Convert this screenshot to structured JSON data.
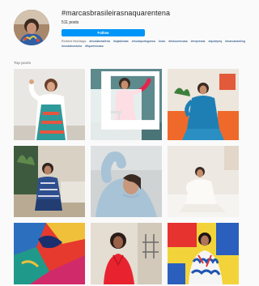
{
  "hashtag": {
    "title": "#marcasbrasileirasnaquarentena",
    "post_count": "511 posts",
    "follow_label": "Follow"
  },
  "related": {
    "label": "Related Hashtags:",
    "tags": [
      "#modabrasileira",
      "#lojaslindas",
      "#modaportuguesa",
      "#ocio",
      "#estouemcasa",
      "#empresas",
      "#apoiepeq",
      "#marcasdoblog",
      "#modaborracha",
      "#fiqueemcasa"
    ]
  },
  "section": {
    "label": "Top posts"
  },
  "posts": [
    {
      "name": "post-woman-paisley-dress-white-wall",
      "multi": false
    },
    {
      "name": "post-woman-red-outfit-sitting",
      "multi": true
    },
    {
      "name": "post-woman-blue-dress-orange-chairs",
      "multi": false
    },
    {
      "name": "post-woman-sitting-living-room",
      "multi": false
    },
    {
      "name": "post-woman-blue-sweater-closeup",
      "multi": false
    },
    {
      "name": "post-woman-white-outfit-bed",
      "multi": false
    },
    {
      "name": "post-colorful-fabric-close",
      "multi": false
    },
    {
      "name": "post-woman-red-shirt-kitchen",
      "multi": false
    },
    {
      "name": "post-woman-patterned-shirt-colorful-wall",
      "multi": false
    }
  ],
  "colors": {
    "follow_bg": "#0095f6",
    "link": "#00376b"
  }
}
